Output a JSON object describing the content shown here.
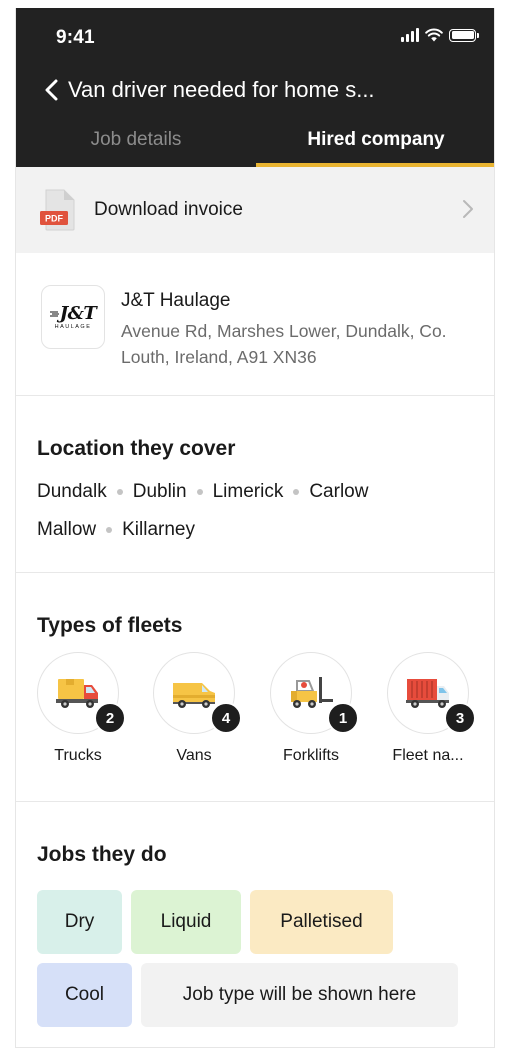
{
  "status_bar": {
    "time": "9:41"
  },
  "header": {
    "title": "Van driver needed for home s...",
    "tabs": [
      {
        "label": "Job details",
        "active": false
      },
      {
        "label": "Hired company",
        "active": true
      }
    ],
    "accent_color": "#e9b431",
    "background_color": "#222222"
  },
  "invoice": {
    "label": "Download invoice",
    "icon": "pdf-icon",
    "badge": "PDF"
  },
  "company": {
    "logo_text": "J&T",
    "logo_subtext": "HAULAGE",
    "name": "J&T Haulage",
    "address": "Avenue Rd, Marshes Lower, Dundalk, Co. Louth, Ireland, A91 XN36"
  },
  "locations": {
    "title": "Location they cover",
    "items": [
      "Dundalk",
      "Dublin",
      "Limerick",
      "Carlow",
      "Mallow",
      "Killarney"
    ]
  },
  "fleets": {
    "title": "Types of fleets",
    "items": [
      {
        "label": "Trucks",
        "count": "2",
        "icon": "truck-icon"
      },
      {
        "label": "Vans",
        "count": "4",
        "icon": "van-icon"
      },
      {
        "label": "Forklifts",
        "count": "1",
        "icon": "forklift-icon"
      },
      {
        "label": "Fleet na...",
        "count": "3",
        "icon": "container-truck-icon"
      }
    ]
  },
  "jobs": {
    "title": "Jobs they do",
    "chips": [
      {
        "label": "Dry",
        "color": "#d8f0ea"
      },
      {
        "label": "Liquid",
        "color": "#dcf3d3"
      },
      {
        "label": "Palletised",
        "color": "#fbeac3"
      },
      {
        "label": "Cool",
        "color": "#d6e0f8"
      },
      {
        "label": "Job type will be shown here",
        "color": "#f2f2f2"
      }
    ]
  }
}
